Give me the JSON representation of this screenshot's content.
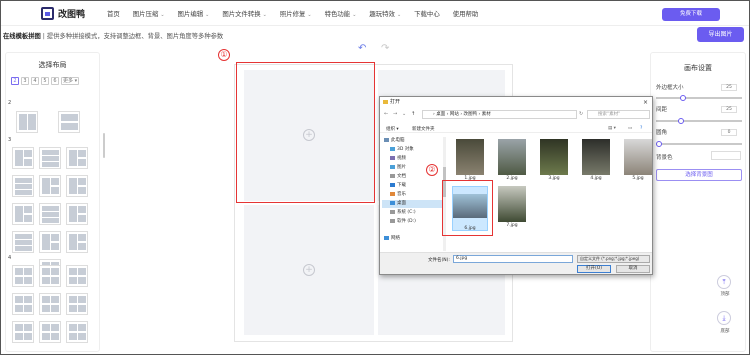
{
  "app": {
    "name": "改图鸭"
  },
  "nav": [
    "首页",
    "图片压缩",
    "图片编辑",
    "图片文件转换",
    "照片修复",
    "特色功能",
    "趣玩特效",
    "下载中心",
    "使用帮助"
  ],
  "nav_dropdown": [
    false,
    true,
    true,
    true,
    true,
    true,
    true,
    false,
    false
  ],
  "download_btn": "免费下载",
  "crumb": {
    "title": "在线模板拼图",
    "desc": " | 提供多种拼接模式，支持调整边框、背景、图片角度等多种参数"
  },
  "export_btn": "导出图片",
  "left": {
    "title": "选择布局",
    "tabs": [
      "2",
      "3",
      "4",
      "5",
      "6",
      "更多 ▾"
    ],
    "sections": [
      "2",
      "3",
      "4"
    ]
  },
  "right": {
    "title": "画布设置",
    "outer_label": "外边框大小",
    "outer_val": "25",
    "inner_label": "间距",
    "inner_val": "25",
    "radius_label": "圆角",
    "radius_val": "0",
    "bg_label": "背景色",
    "bg_btn": "选择背景图",
    "top_label": "顶部",
    "bottom_label": "底部"
  },
  "annotations": {
    "one": "①",
    "two": "②"
  },
  "dialog": {
    "title": "打开",
    "close": "×",
    "path": "› 桌面 › 网站 › 改图鸭 › 素材",
    "search": "搜索\"素材\"",
    "organize": "组织 ▾",
    "new_folder": "新建文件夹",
    "tree": [
      "此电脑",
      "3D 对象",
      "视频",
      "图片",
      "文档",
      "下载",
      "音乐",
      "桌面",
      "系统 (C:)",
      "软件 (D:)",
      "网络"
    ],
    "tree_selected": 7,
    "files": [
      {
        "name": "1.jpg",
        "c1": "#4a4a3a",
        "c2": "#8a8270"
      },
      {
        "name": "2.jpg",
        "c1": "#9aa3a8",
        "c2": "#4f5a44"
      },
      {
        "name": "3.jpg",
        "c1": "#2f3424",
        "c2": "#6d7a4c"
      },
      {
        "name": "4.jpg",
        "c1": "#2d2e2a",
        "c2": "#787a6a"
      },
      {
        "name": "5.jpg",
        "c1": "#d8d8d8",
        "c2": "#8c8478"
      },
      {
        "name": "6.jpg",
        "c1": "#9fc2d8",
        "c2": "#5a6a7a"
      },
      {
        "name": "7.jpg",
        "c1": "#c7c9c0",
        "c2": "#3f4a33"
      }
    ],
    "file_selected": 5,
    "filename_label": "文件名(N):",
    "filename": "6.jpg",
    "filetype": "自定义文件 (*.png;*.jpg;*.jpeg)",
    "open": "打开(O)",
    "cancel": "取消"
  }
}
